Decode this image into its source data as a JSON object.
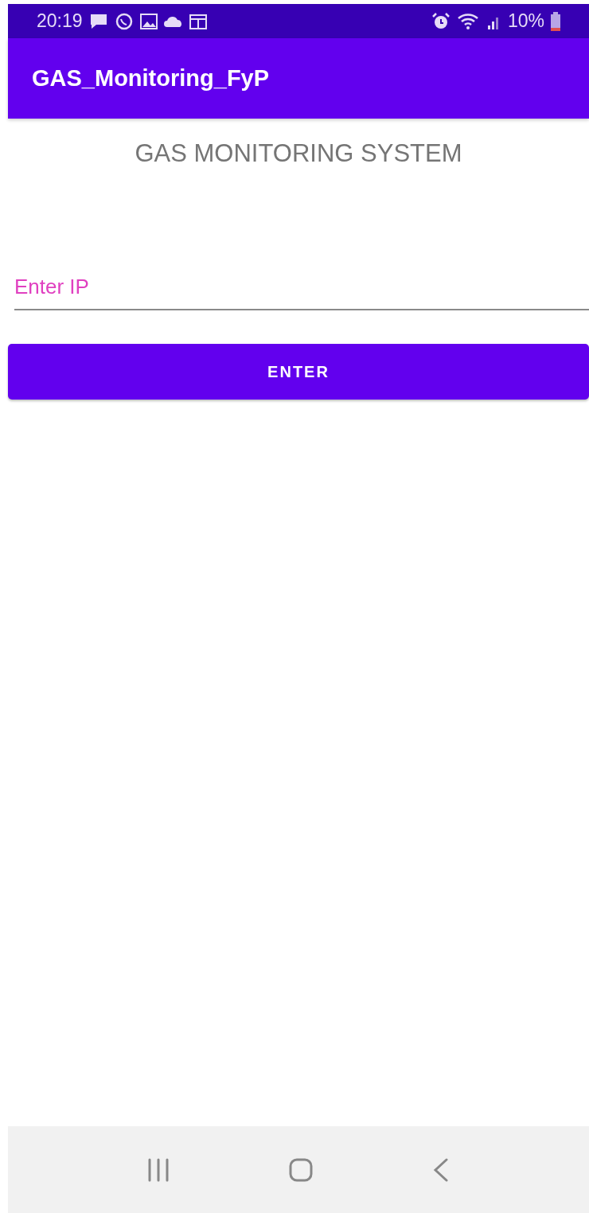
{
  "status_bar": {
    "time": "20:19",
    "battery": "10%"
  },
  "app_bar": {
    "title": "GAS_Monitoring_FyP"
  },
  "heading": "GAS MONITORING SYSTEM",
  "ip_field": {
    "placeholder": "Enter IP"
  },
  "buttons": [
    "ENTER"
  ]
}
